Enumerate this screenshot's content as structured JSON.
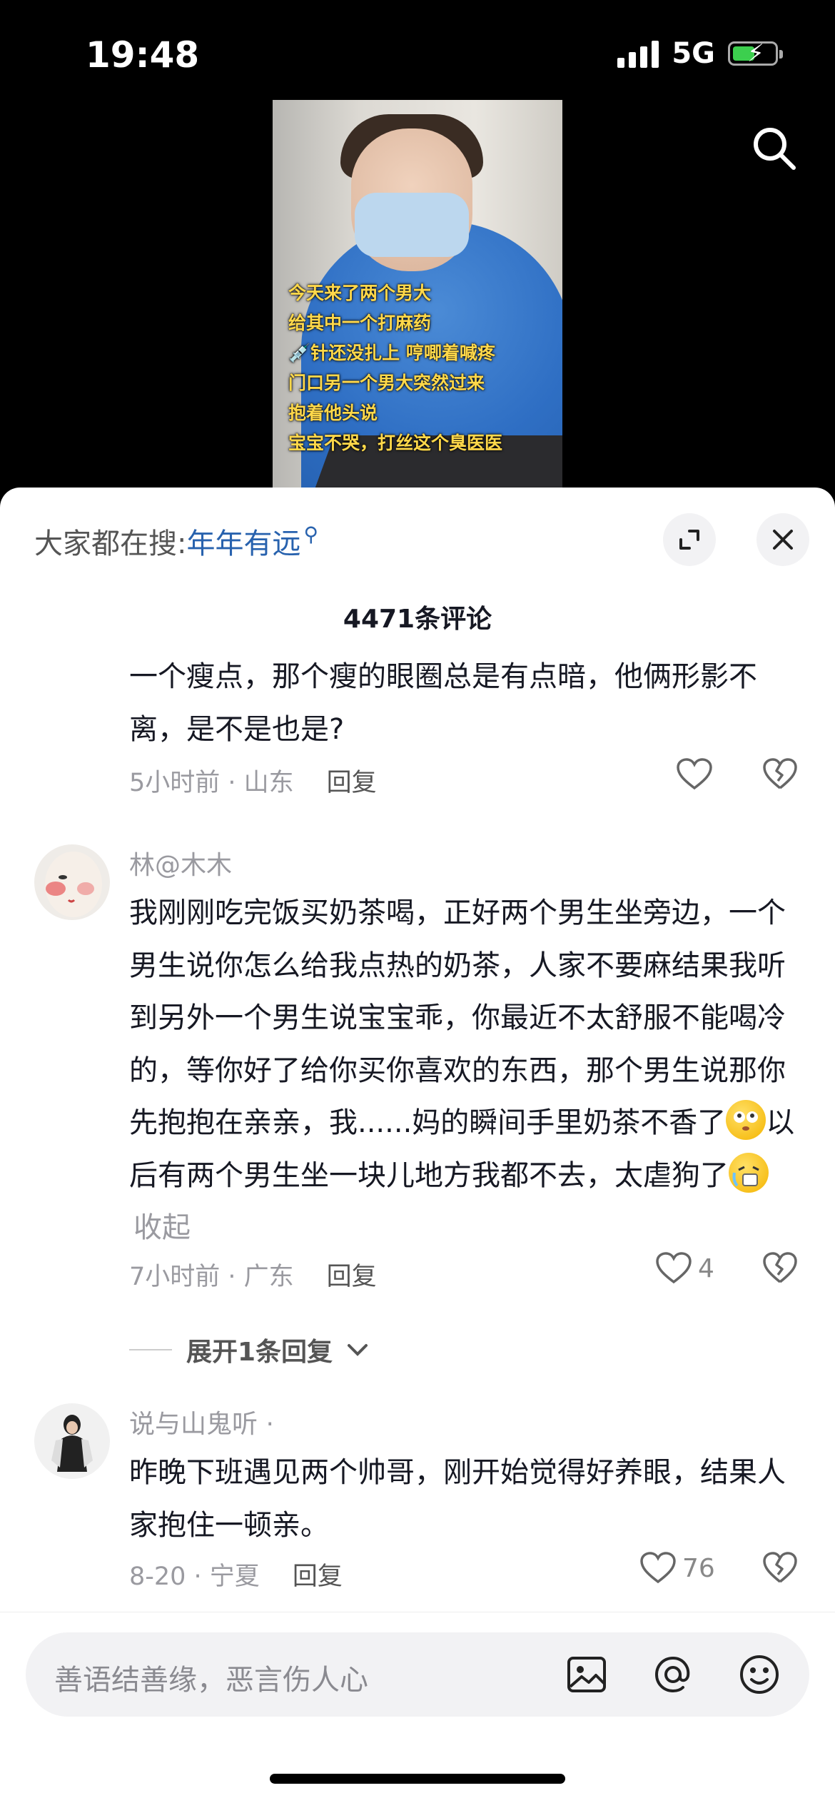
{
  "status_bar": {
    "time": "19:48",
    "network": "5G"
  },
  "video": {
    "caption_lines": [
      "今天来了两个男大",
      "给其中一个打麻药",
      "💉针还没扎上 哼唧着喊疼",
      "门口另一个男大突然过来",
      "抱着他头说",
      "宝宝不哭，打丝这个臭医医"
    ]
  },
  "sheet": {
    "hot_search_prefix": "大家都在搜:",
    "hot_search_term": "年年有远",
    "comment_count": "4471条评论"
  },
  "comments": [
    {
      "text": "一个瘦点，那个瘦的眼圈总是有点暗，他俩形影不离，是不是也是?",
      "time_location": "5小时前 · 山东",
      "reply_label": "回复",
      "likes": ""
    },
    {
      "author": "林@木木",
      "text_before": "我刚刚吃完饭买奶茶喝，正好两个男生坐旁边，一个男生说你怎么给我点热的奶茶，人家不要麻结果我听到另外一个男生说宝宝乖，你最近不太舒服不能喝冷的，等你好了给你买你喜欢的东西，那个男生说那你先抱抱在亲亲，我......妈的瞬间手里奶茶不香了",
      "text_middle": "以后有两个男生坐一块儿地方我都不去，太虐狗了",
      "collapse_label": "收起",
      "time_location": "7小时前 · 广东",
      "reply_label": "回复",
      "likes": "4",
      "expand_replies": "展开1条回复"
    },
    {
      "author": "说与山鬼听 ·",
      "text": "昨晚下班遇见两个帅哥，刚开始觉得好养眼，结果人家抱住一顿亲。",
      "time_location": "8-20 · 宁夏",
      "reply_label": "回复",
      "likes": "76"
    }
  ],
  "input_bar": {
    "placeholder": "善语结善缘，恶言伤人心"
  }
}
